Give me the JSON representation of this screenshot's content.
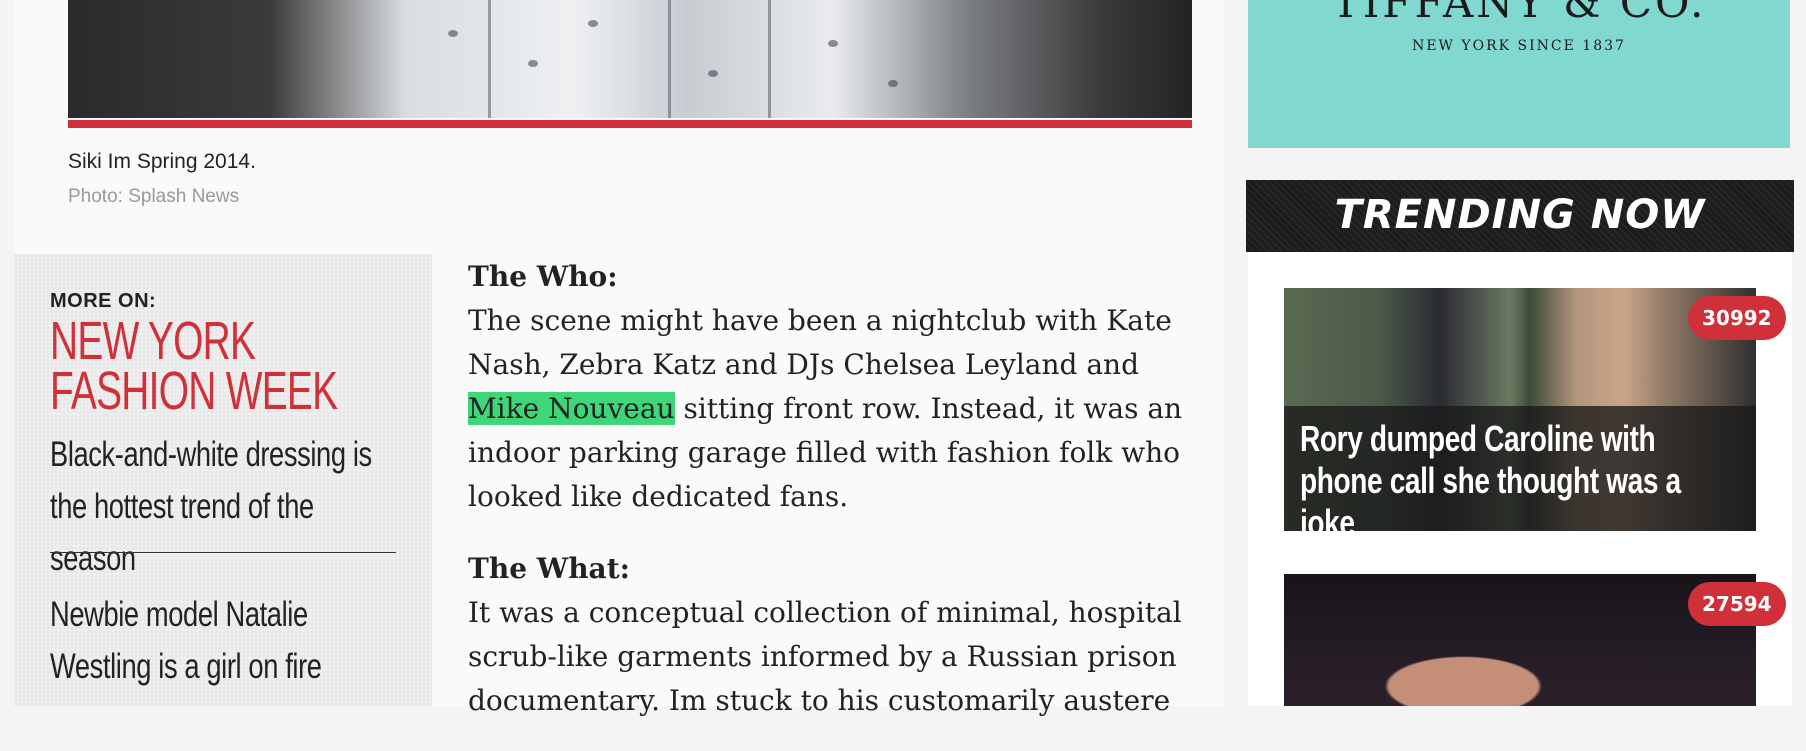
{
  "photo": {
    "caption": "Siki Im Spring 2014.",
    "credit": "Photo: Splash News"
  },
  "more_on": {
    "label": "MORE ON:",
    "title": "NEW YORK FASHION WEEK",
    "links": [
      "Black-and-white dressing is the hottest trend of the season",
      "Newbie model Natalie Westling is a girl on fire"
    ]
  },
  "article": {
    "who_heading": "The Who:",
    "who_text_before": "The scene might have been a nightclub with Kate Nash, Zebra Katz and DJs Chelsea Leyland and ",
    "who_highlight": "Mike Nouveau",
    "who_text_after": " sitting front row. Instead, it was an indoor parking garage filled with fashion folk who looked like dedicated fans.",
    "what_heading": "The What:",
    "what_text": "It was a conceptual collection of minimal, hospital scrub-like garments informed by a Russian prison documentary. Im stuck to his customarily austere"
  },
  "ad": {
    "logo": "TIFFANY & CO.",
    "tagline": "NEW YORK SINCE 1837",
    "background": "#81d8d0"
  },
  "trending": {
    "heading": "TRENDING NOW",
    "stories": [
      {
        "title": "Rory dumped Caroline with phone call she thought was a joke",
        "count": "30992"
      },
      {
        "title": "",
        "count": "27594"
      }
    ]
  },
  "colors": {
    "accent": "#d0303a",
    "highlight": "#3fd67a"
  }
}
